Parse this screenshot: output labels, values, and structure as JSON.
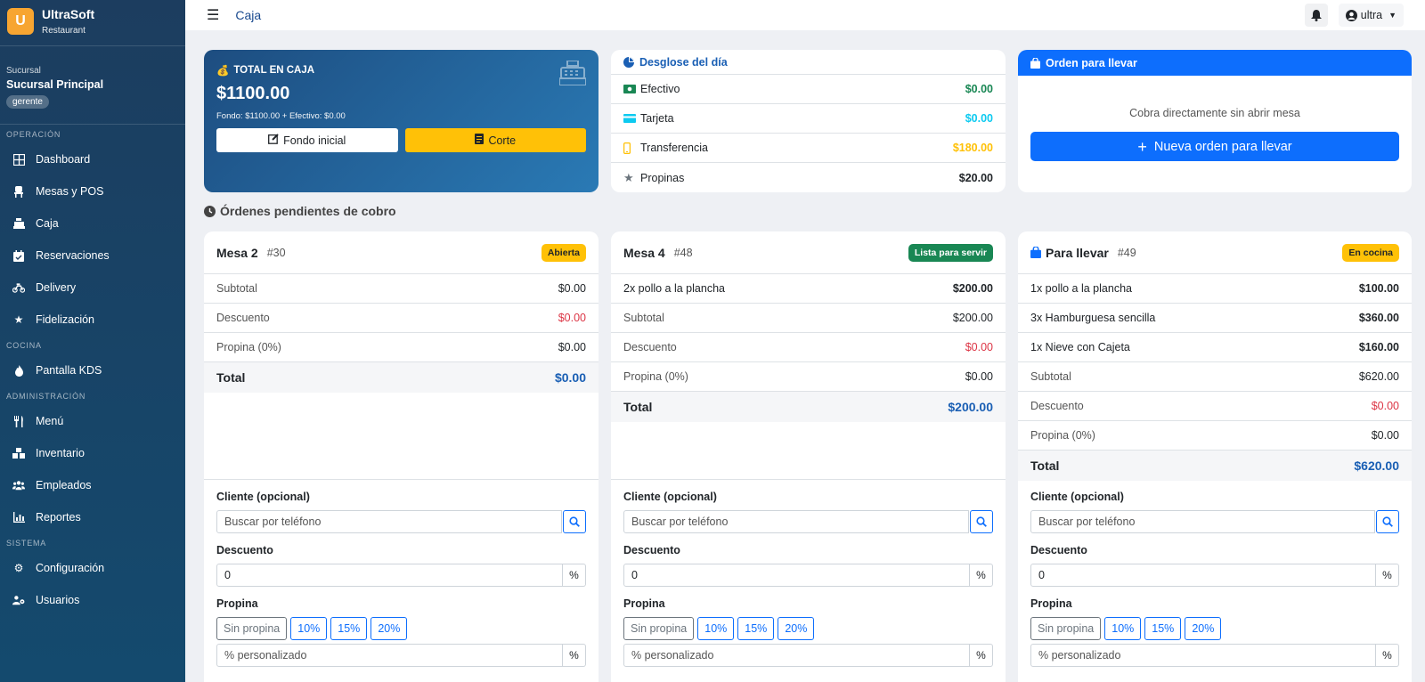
{
  "brand": {
    "name": "UltraSoft",
    "sub": "Restaurant",
    "logo_letter": "U"
  },
  "branch": {
    "label": "Sucursal",
    "name": "Sucursal Principal",
    "role": "gerente"
  },
  "nav": {
    "sec_operacion": "OPERACIÓN",
    "dashboard": "Dashboard",
    "mesas": "Mesas y POS",
    "caja": "Caja",
    "reservaciones": "Reservaciones",
    "delivery": "Delivery",
    "fidelizacion": "Fidelización",
    "sec_cocina": "COCINA",
    "kds": "Pantalla KDS",
    "sec_admin": "ADMINISTRACIÓN",
    "menu": "Menú",
    "inventario": "Inventario",
    "empleados": "Empleados",
    "reportes": "Reportes",
    "sec_sistema": "SISTEMA",
    "configuracion": "Configuración",
    "usuarios": "Usuarios"
  },
  "topbar": {
    "title": "Caja",
    "user": "ultra"
  },
  "caja": {
    "label": "TOTAL EN CAJA",
    "amount": "$1100.00",
    "detail": "Fondo: $1100.00 + Efectivo: $0.00",
    "btn_fondo": "Fondo inicial",
    "btn_corte": "Corte"
  },
  "desglose": {
    "title": "Desglose del día",
    "efectivo_label": "Efectivo",
    "efectivo_value": "$0.00",
    "tarjeta_label": "Tarjeta",
    "tarjeta_value": "$0.00",
    "transfer_label": "Transferencia",
    "transfer_value": "$180.00",
    "propinas_label": "Propinas",
    "propinas_value": "$20.00"
  },
  "llevar": {
    "title": "Orden para llevar",
    "text": "Cobra directamente sin abrir mesa",
    "btn": "Nueva orden para llevar"
  },
  "pendientes_title": "Órdenes pendientes de cobro",
  "labels": {
    "subtotal": "Subtotal",
    "descuento": "Descuento",
    "propina": "Propina (0%)",
    "total": "Total",
    "cliente": "Cliente (opcional)",
    "cliente_ph": "Buscar por teléfono",
    "descuento_field": "Descuento",
    "descuento_value": "0",
    "pct": "%",
    "propina_field": "Propina",
    "tip_none": "Sin propina",
    "tip_10": "10%",
    "tip_15": "15%",
    "tip_20": "20%",
    "custom_ph": "% personalizado"
  },
  "orders": [
    {
      "title": "Mesa 2",
      "num": "#30",
      "status": "Abierta",
      "subtotal": "$0.00",
      "descuento": "$0.00",
      "propina": "$0.00",
      "total": "$0.00"
    },
    {
      "title": "Mesa 4",
      "num": "#48",
      "status": "Lista para servir",
      "items": [
        {
          "name": "2x pollo a la plancha",
          "price": "$200.00"
        }
      ],
      "subtotal": "$200.00",
      "descuento": "$0.00",
      "propina": "$0.00",
      "total": "$200.00"
    },
    {
      "title": "Para llevar",
      "num": "#49",
      "status": "En cocina",
      "items": [
        {
          "name": "1x pollo a la plancha",
          "price": "$100.00"
        },
        {
          "name": "3x Hamburguesa sencilla",
          "price": "$360.00"
        },
        {
          "name": "1x Nieve con Cajeta",
          "price": "$160.00"
        }
      ],
      "subtotal": "$620.00",
      "descuento": "$0.00",
      "propina": "$0.00",
      "total": "$620.00"
    }
  ],
  "colors": {
    "sidebar": "#1c3d5f",
    "accent": "#0d6efd",
    "warning": "#ffc107",
    "success": "#198754",
    "danger": "#dc3545",
    "brand_logo": "#f7a531"
  },
  "icons": {
    "bell": "bell-icon",
    "user": "user-circle-icon",
    "register": "cash-register-icon",
    "money_bag": "money-bag-icon",
    "pie": "pie-chart-icon",
    "bag": "shopping-bag-icon",
    "clock": "clock-icon",
    "search": "search-icon"
  }
}
